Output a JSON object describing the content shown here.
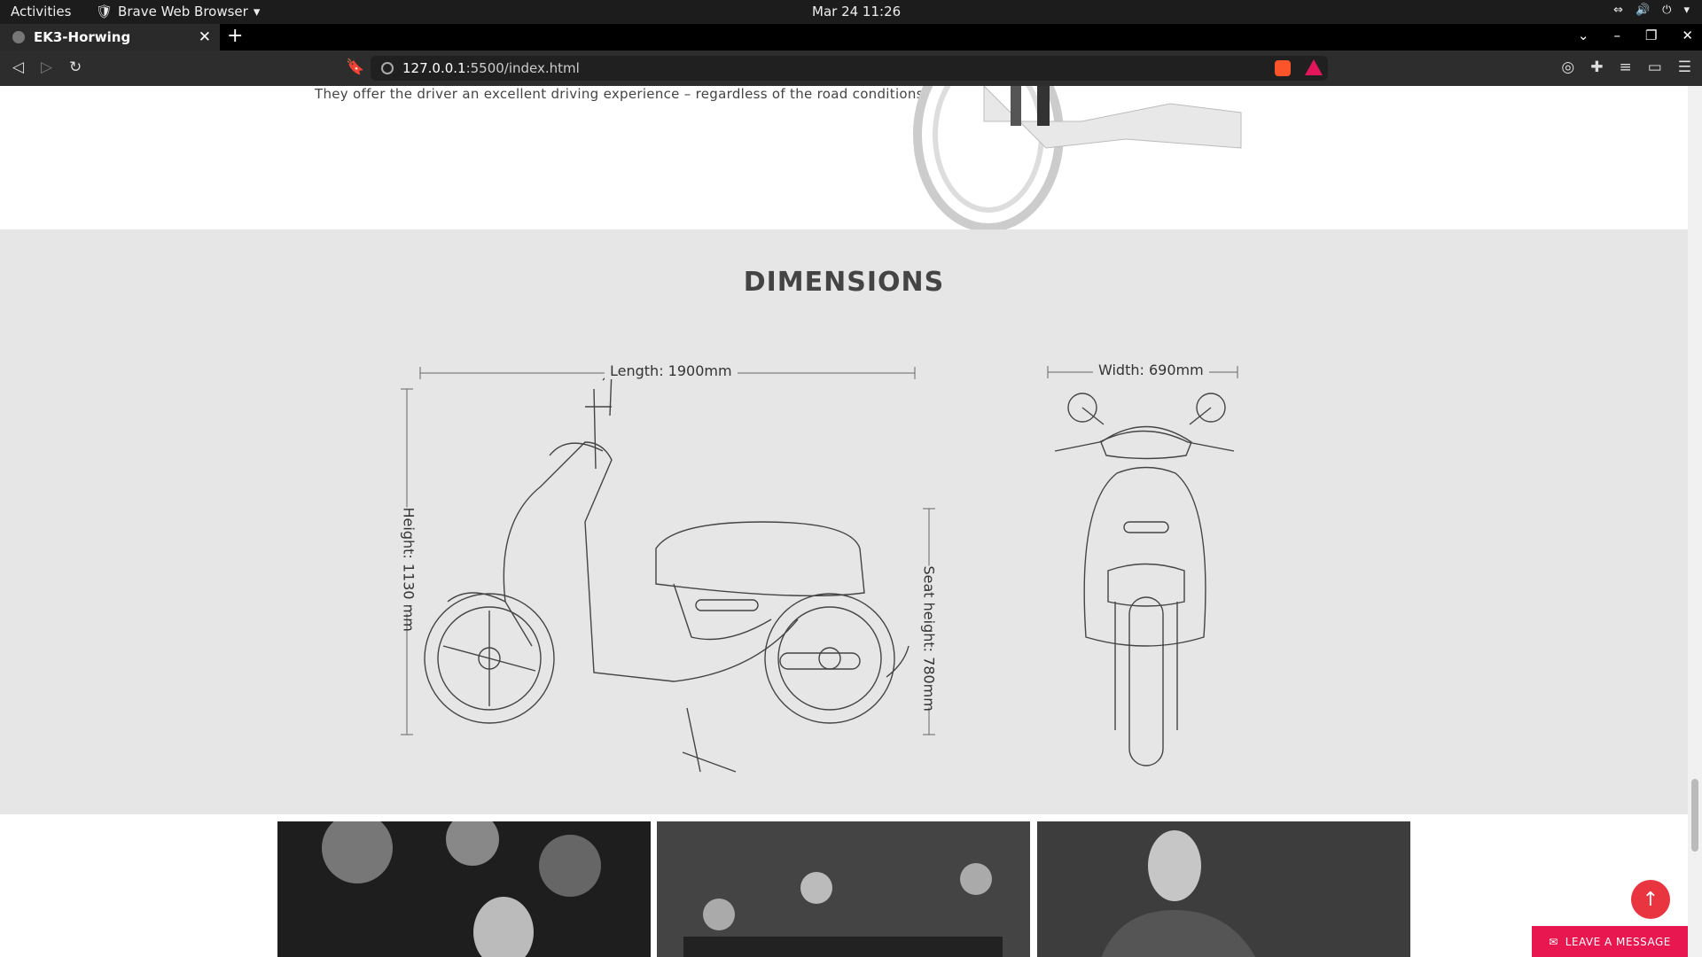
{
  "system": {
    "activities": "Activities",
    "app_name": "Brave Web Browser",
    "clock": "Mar 24  11:26"
  },
  "browser": {
    "tab_title": "EK3-Horwing",
    "url_host": "127.0.0.1",
    "url_path": ":5500/index.html"
  },
  "page": {
    "intro_text": "They offer the driver an excellent driving experience – regardless of the road conditions.",
    "dimensions_title": "DIMENSIONS",
    "length_label": "Length: 1900mm",
    "width_label": "Width: 690mm",
    "height_label": "Height: 1130 mm",
    "seat_height_label": "Seat height: 780mm",
    "leave_message": "LEAVE A MESSAGE"
  }
}
